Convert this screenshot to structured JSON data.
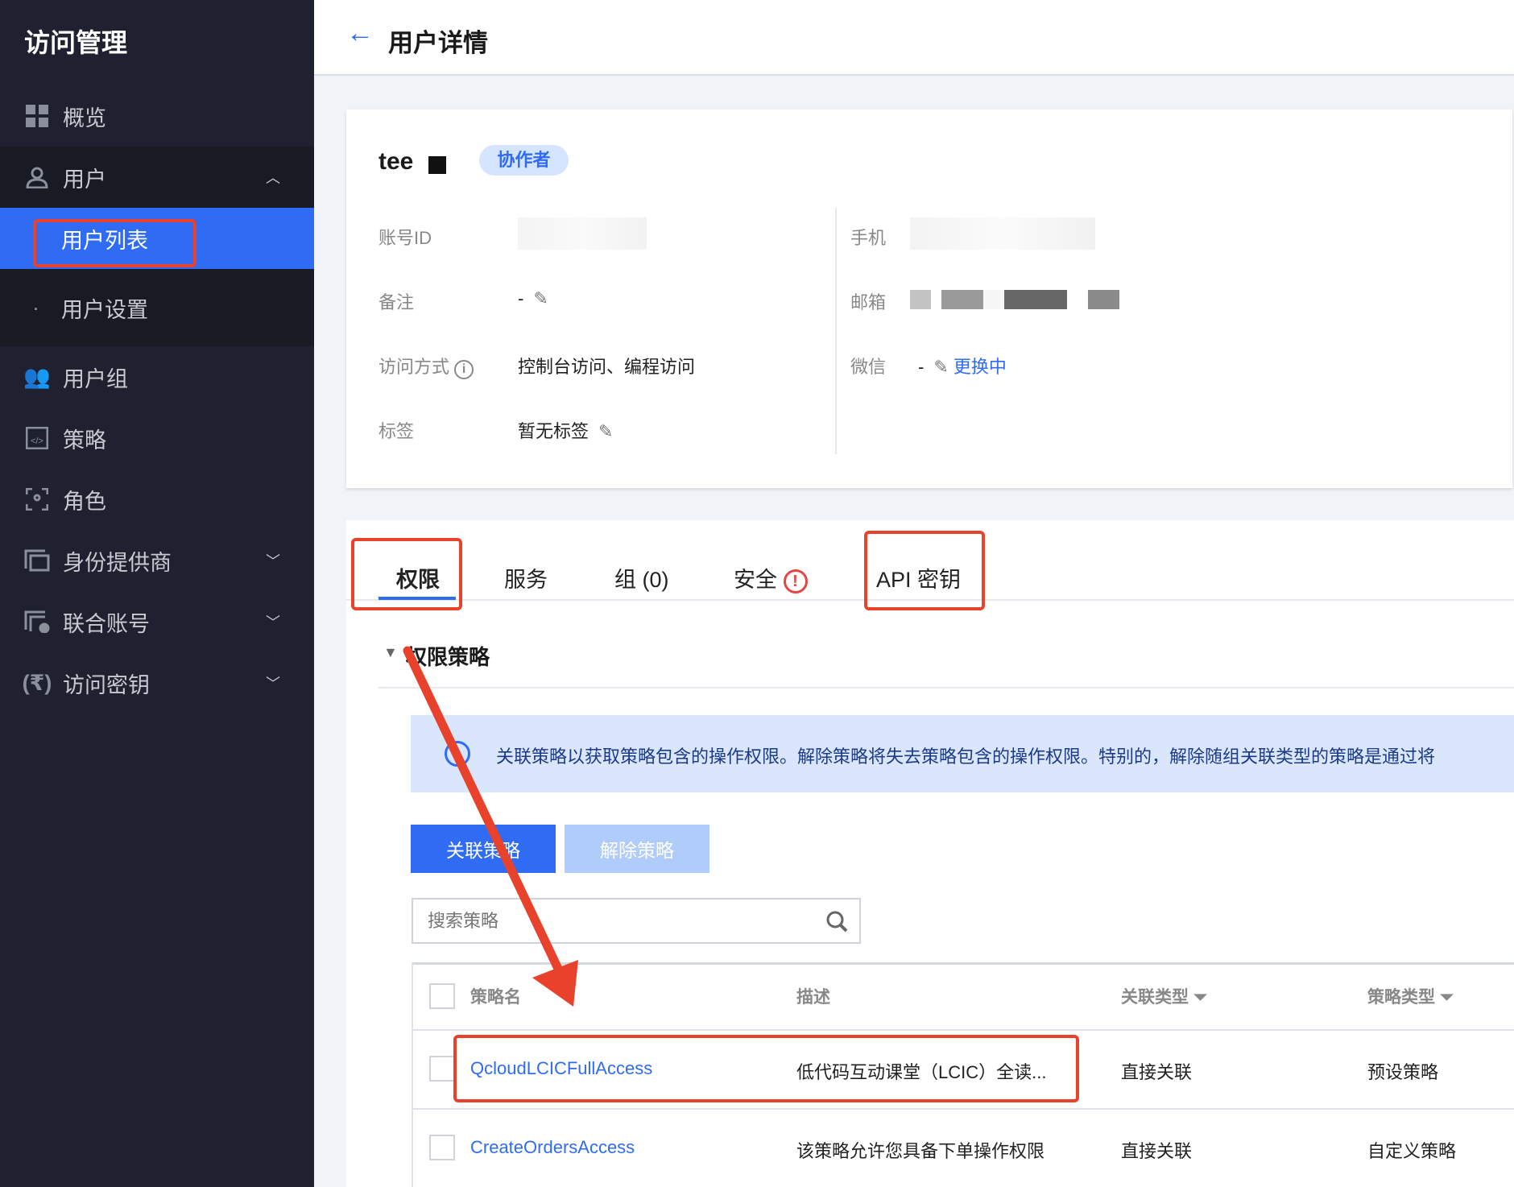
{
  "sidebar": {
    "title": "访问管理",
    "items": [
      {
        "label": "概览",
        "icon": "grid-icon"
      },
      {
        "label": "用户",
        "icon": "user-icon"
      },
      {
        "label": "用户列表"
      },
      {
        "label": "用户设置"
      },
      {
        "label": "用户组",
        "icon": "users-icon"
      },
      {
        "label": "策略",
        "icon": "policy-icon"
      },
      {
        "label": "角色",
        "icon": "role-icon"
      },
      {
        "label": "身份提供商",
        "icon": "idp-icon"
      },
      {
        "label": "联合账号",
        "icon": "federation-icon"
      },
      {
        "label": "访问密钥",
        "icon": "key-icon"
      }
    ]
  },
  "header": {
    "title": "用户详情"
  },
  "user": {
    "name": "tee",
    "badge": "协作者",
    "fields_left": [
      {
        "label": "账号ID",
        "value": ""
      },
      {
        "label": "备注",
        "value": "-"
      },
      {
        "label": "访问方式",
        "value": "控制台访问、编程访问"
      },
      {
        "label": "标签",
        "value": "暂无标签"
      }
    ],
    "fields_right": [
      {
        "label": "手机",
        "value": ""
      },
      {
        "label": "邮箱",
        "value": ""
      },
      {
        "label": "微信",
        "value": "-",
        "link": "更换中"
      }
    ]
  },
  "tabs": [
    "权限",
    "服务",
    "组 (0)",
    "安全",
    "API 密钥"
  ],
  "section": {
    "title": "权限策略",
    "info": "关联策略以获取策略包含的操作权限。解除策略将失去策略包含的操作权限。特别的，解除随组关联类型的策略是通过将",
    "attach_label": "关联策略",
    "detach_label": "解除策略",
    "search_placeholder": "搜索策略"
  },
  "table": {
    "headers": [
      "策略名",
      "描述",
      "关联类型",
      "策略类型"
    ],
    "rows": [
      {
        "name": "QcloudLCICFullAccess",
        "desc": "低代码互动课堂（LCIC）全读...",
        "assoc": "直接关联",
        "type": "预设策略"
      },
      {
        "name": "CreateOrdersAccess",
        "desc": "该策略允许您具备下单操作权限",
        "assoc": "直接关联",
        "type": "自定义策略"
      }
    ]
  }
}
